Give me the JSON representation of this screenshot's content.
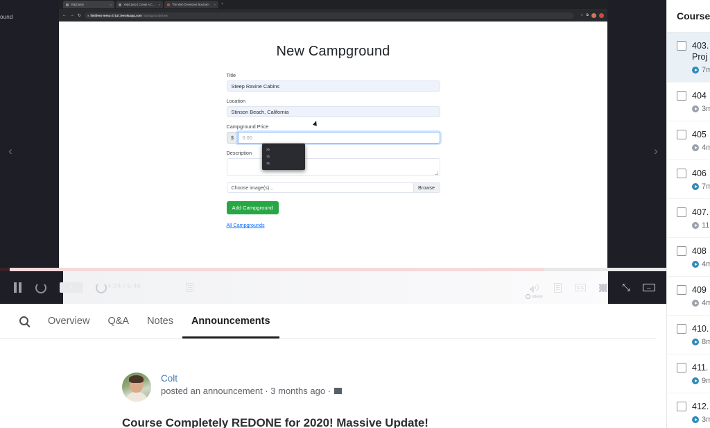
{
  "browser": {
    "tabs": [
      {
        "label": "YelpCamp",
        "active": true,
        "favicon": "gray"
      },
      {
        "label": "YelpCamp | Create A Campgr",
        "active": false,
        "favicon": "gray"
      },
      {
        "label": "The Web Developer Bootcam",
        "active": false,
        "favicon": "red"
      }
    ],
    "new_tab_icon": "+",
    "back_icon": "←",
    "forward_icon": "→",
    "reload_icon": "↻",
    "lock_icon": "🔒",
    "url_domain": "limitless-mesa-27147.herokuapp.com",
    "url_path": "/campgrounds/new",
    "star_icon": "☆",
    "extension_icon": "⧉",
    "ghost_title": "ound"
  },
  "page": {
    "heading": "New Campground",
    "fields": [
      {
        "label": "Title",
        "value": "Steep Ravine Cabins"
      },
      {
        "label": "Location",
        "value": "Stinson Beach, California"
      }
    ],
    "price": {
      "label": "Campground Price",
      "prefix": "$",
      "placeholder": "0.00"
    },
    "description": {
      "label": "Description",
      "value": ""
    },
    "file": {
      "text": "Choose image(s)...",
      "browse_label": "Browse"
    },
    "submit_label": "Add Campground",
    "all_link": "All Campgrounds",
    "autofill_options": [
      "25",
      "15",
      "35"
    ]
  },
  "player": {
    "prev_icon": "‹",
    "next_icon": "›",
    "pause_icon": "pause",
    "rewind_icon": "rewind-10",
    "forward_icon": "forward-10",
    "speed_label": "x",
    "time": "4:04 / 6:46",
    "note_icon": "note",
    "volume_icon": "volume",
    "transcript_icon": "transcript",
    "cc_icon": "closed-captions",
    "settings_icon": "gear",
    "expand_icon": "⤡",
    "theater_icon": "↔",
    "watermark": "Udemy",
    "progress_percent": 60
  },
  "tabs": {
    "search_icon": "search",
    "items": [
      {
        "label": "Overview",
        "active": false
      },
      {
        "label": "Q&A",
        "active": false
      },
      {
        "label": "Notes",
        "active": false
      },
      {
        "label": "Announcements",
        "active": true
      }
    ]
  },
  "announcement": {
    "author": "Colt",
    "meta": "posted an announcement · 3 months ago ·",
    "flag_icon": "flag",
    "title": "Course Completely REDONE for 2020! Massive Update!"
  },
  "sidebar": {
    "heading": "Course",
    "items": [
      {
        "num": "403.",
        "title": "Proj",
        "duration": "7m",
        "current": true,
        "watched": true
      },
      {
        "num": "404",
        "title": "",
        "duration": "3m",
        "current": false,
        "watched": false
      },
      {
        "num": "405",
        "title": "",
        "duration": "4m",
        "current": false,
        "watched": false
      },
      {
        "num": "406",
        "title": "",
        "duration": "7m",
        "current": false,
        "watched": true
      },
      {
        "num": "407.",
        "title": "",
        "duration": "11",
        "current": false,
        "watched": false
      },
      {
        "num": "408",
        "title": "",
        "duration": "4m",
        "current": false,
        "watched": true
      },
      {
        "num": "409",
        "title": "",
        "duration": "4m",
        "current": false,
        "watched": false
      },
      {
        "num": "410.",
        "title": "",
        "duration": "8m",
        "current": false,
        "watched": true
      },
      {
        "num": "411.",
        "title": "",
        "duration": "9m",
        "current": false,
        "watched": true
      },
      {
        "num": "412.",
        "title": "",
        "duration": "3m",
        "current": false,
        "watched": true
      }
    ]
  },
  "colors": {
    "accent_green": "#28a745",
    "link_blue": "#0d6efd",
    "player_dark": "#1e1e26",
    "highlight": "#e9f1f7"
  }
}
